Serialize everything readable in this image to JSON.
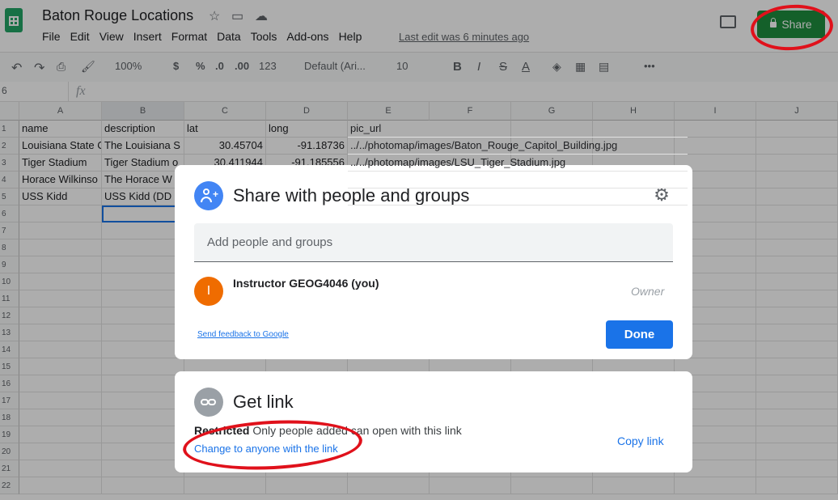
{
  "header": {
    "title": "Baton Rouge Locations",
    "menu": [
      "File",
      "Edit",
      "View",
      "Insert",
      "Format",
      "Data",
      "Tools",
      "Add-ons",
      "Help"
    ],
    "last_edit": "Last edit was 6 minutes ago",
    "share_label": "Share"
  },
  "toolbar": {
    "zoom": "100%",
    "currency": "$",
    "percent": "%",
    "decimal_decrease": ".0",
    "decimal_increase": ".00",
    "more_formats": "123",
    "font": "Default (Ari...",
    "font_size": "10",
    "bold": "B",
    "italic": "I",
    "strike": "S",
    "text_color": "A",
    "more": "•••"
  },
  "formula_bar": {
    "cell_ref": "6",
    "fx": "fx"
  },
  "grid": {
    "columns": [
      "A",
      "B",
      "C",
      "D",
      "E",
      "F",
      "G",
      "H",
      "I",
      "J"
    ],
    "rows": [
      "1",
      "2",
      "3",
      "4",
      "5",
      "6",
      "7",
      "8",
      "9",
      "10",
      "11",
      "12",
      "13",
      "14",
      "15",
      "16",
      "17",
      "18",
      "19",
      "20",
      "21",
      "22"
    ],
    "data": [
      [
        "name",
        "description",
        "lat",
        "long",
        "pic_url"
      ],
      [
        "Louisiana State C",
        "The Louisiana S",
        "30.45704",
        "-91.18736",
        "../../photomap/images/Baton_Rouge_Capitol_Building.jpg"
      ],
      [
        "Tiger Stadium",
        "Tiger Stadium o",
        "30.411944",
        "-91.185556",
        "../../photomap/images/LSU_Tiger_Stadium.jpg"
      ],
      [
        "Horace Wilkinso",
        "The Horace W",
        "",
        "",
        ""
      ],
      [
        "USS Kidd",
        "USS Kidd (DD",
        "",
        "",
        ""
      ]
    ]
  },
  "share_dialog": {
    "title": "Share with people and groups",
    "input_placeholder": "Add people and groups",
    "user_initial": "I",
    "user_name": "Instructor GEOG4046 (you)",
    "user_role": "Owner",
    "feedback": "Send feedback to Google",
    "done": "Done"
  },
  "link_dialog": {
    "title": "Get link",
    "restricted_label": "Restricted",
    "restricted_text": " Only people added can open with this link",
    "change_link": "Change to anyone with the link",
    "copy_link": "Copy link"
  },
  "colors": {
    "share_green": "#1e8e3e",
    "accent_blue": "#1a73e8",
    "annotation_red": "#e0111b",
    "avatar_orange": "#ef6c00"
  }
}
